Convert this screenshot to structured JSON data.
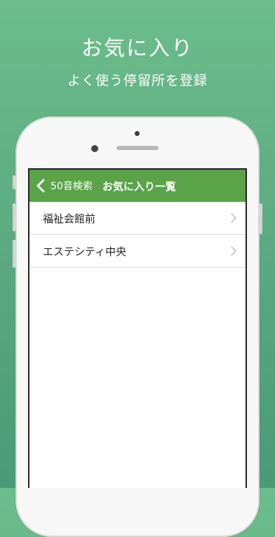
{
  "promo": {
    "title": "お気に入り",
    "subtitle": "よく使う停留所を登録"
  },
  "navbar": {
    "back_label": "50音検索",
    "title": "お気に入り一覧"
  },
  "favorites": [
    {
      "label": "福祉会館前"
    },
    {
      "label": "エステシティ中央"
    }
  ],
  "colors": {
    "background": "#5aa880",
    "navbar": "#5aa348",
    "text": "#222222"
  },
  "icons": [
    "chevron-left-icon",
    "chevron-right-icon"
  ]
}
